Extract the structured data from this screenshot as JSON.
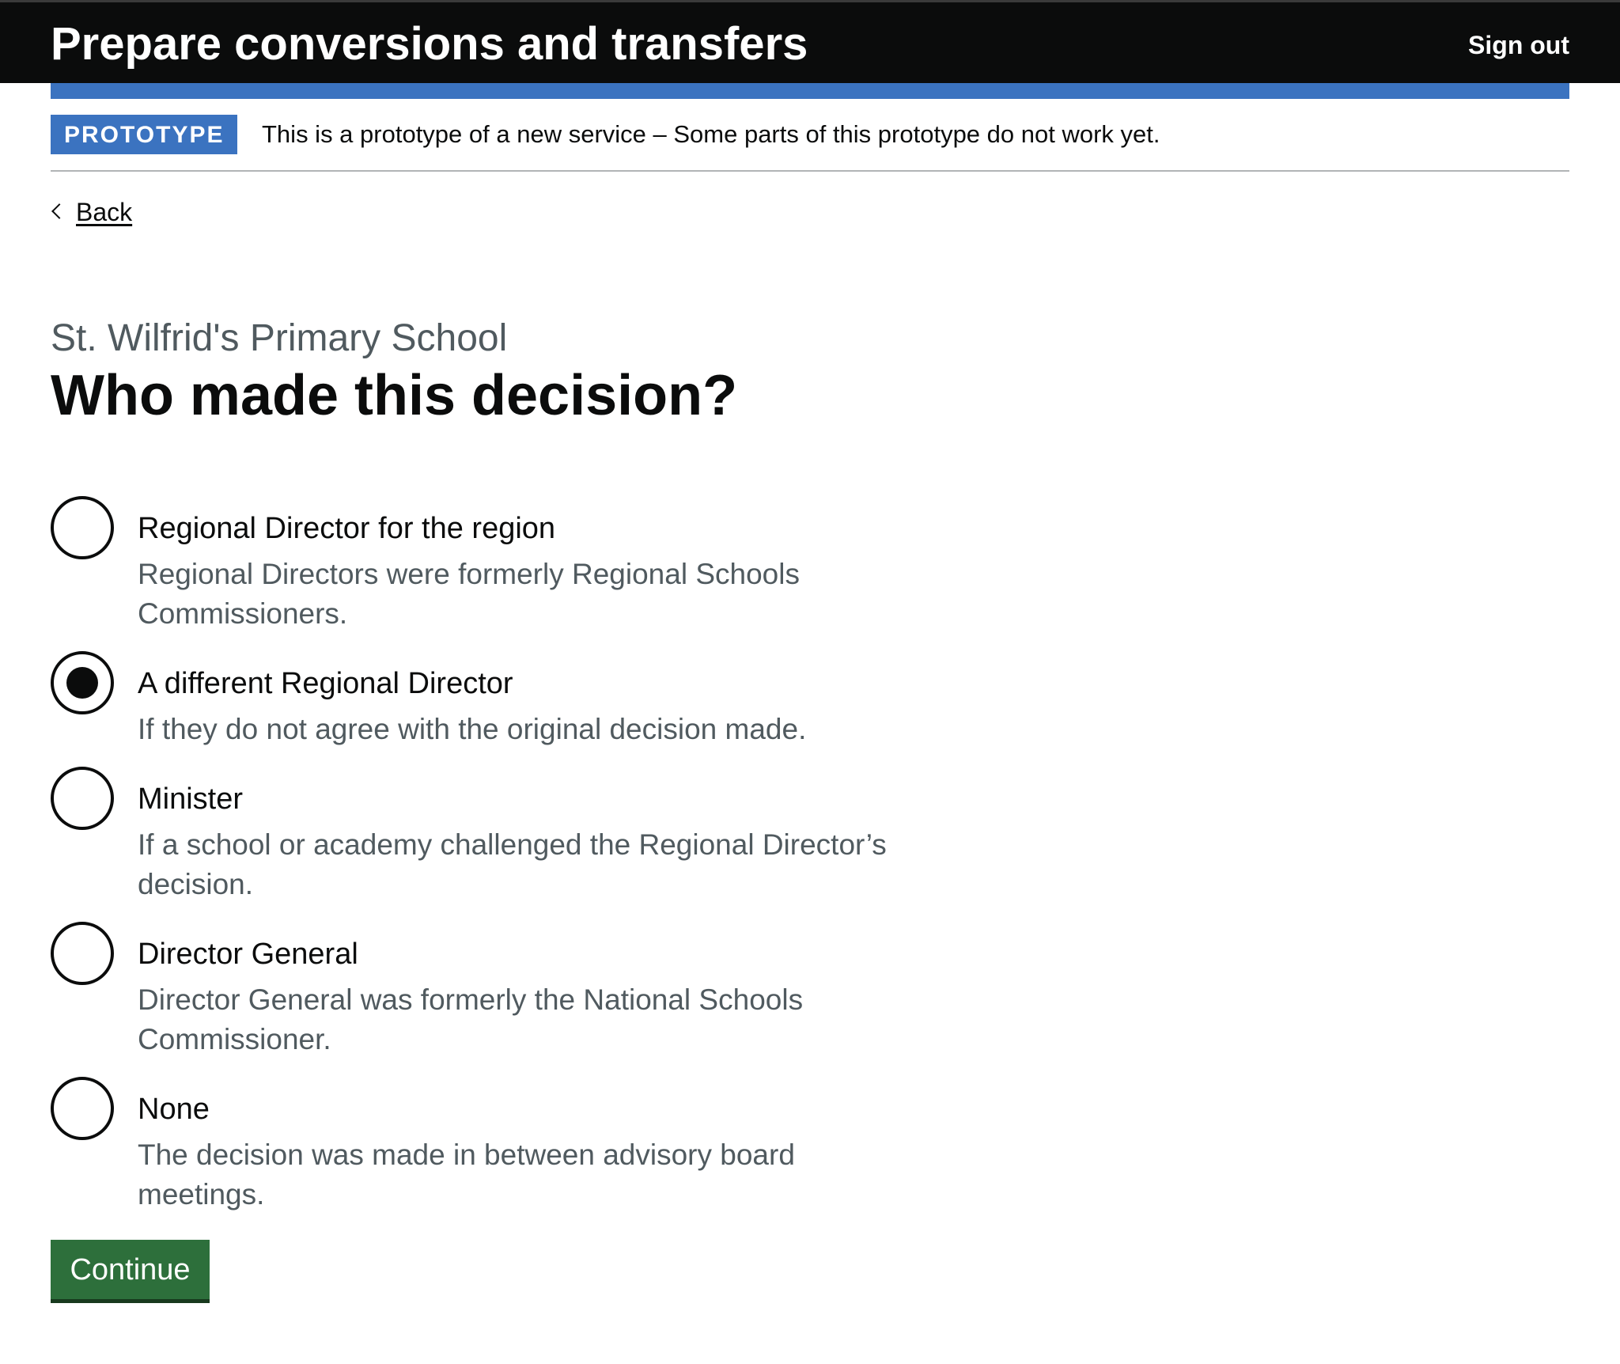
{
  "header": {
    "title": "Prepare conversions and transfers",
    "sign_out": "Sign out"
  },
  "phase_banner": {
    "tag": "PROTOTYPE",
    "text": "This is a prototype of a new service – Some parts of this prototype do not work yet."
  },
  "back_link": "Back",
  "caption": "St. Wilfrid's Primary School",
  "heading": "Who made this decision?",
  "options": [
    {
      "label": "Regional Director for the region",
      "hint": "Regional Directors were formerly Regional Schools Commissioners.",
      "checked": false
    },
    {
      "label": "A different Regional Director",
      "hint": "If they do not agree with the original decision made.",
      "checked": true
    },
    {
      "label": "Minister",
      "hint": "If a school or academy challenged the Regional Director’s decision.",
      "checked": false
    },
    {
      "label": "Director General",
      "hint": "Director General was formerly the National Schools Commissioner.",
      "checked": false
    },
    {
      "label": "None",
      "hint": "The decision was made in between advisory board meetings.",
      "checked": false
    }
  ],
  "continue_button": "Continue",
  "colors": {
    "header_bg": "#0b0c0c",
    "accent_blue": "#3b73c0",
    "button_green": "#2d6f3b",
    "hint_grey": "#505a5f"
  }
}
